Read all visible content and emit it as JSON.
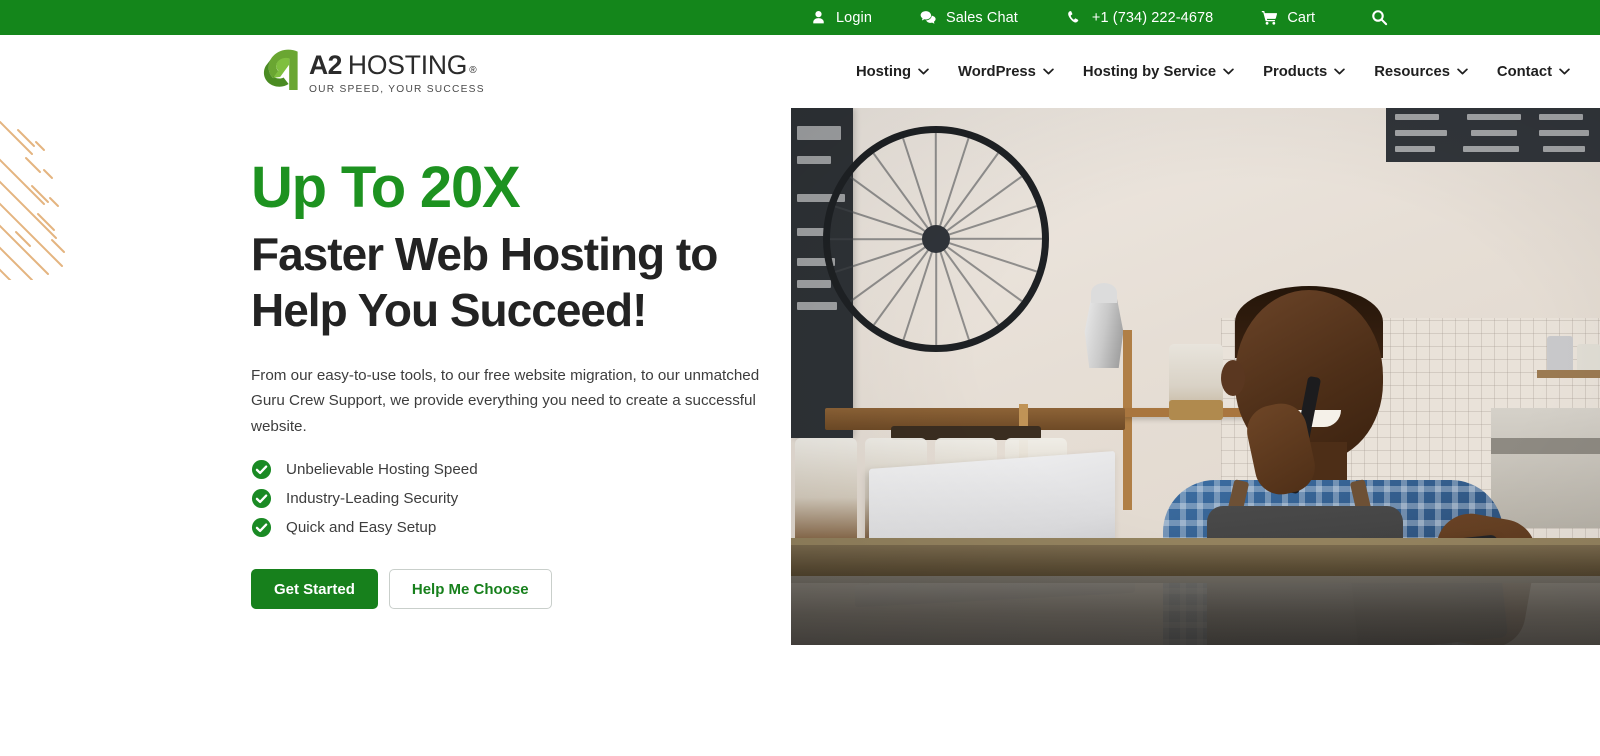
{
  "topbar": {
    "background": "#14861b",
    "items": [
      {
        "label": "Login",
        "icon": "user-icon"
      },
      {
        "label": "Sales Chat",
        "icon": "chat-bubbles-icon"
      },
      {
        "label": "+1 (734) 222-4678",
        "icon": "phone-icon"
      },
      {
        "label": "Cart",
        "icon": "shopping-cart-icon"
      }
    ],
    "search_icon": "search-icon"
  },
  "logo": {
    "mark": "a2-logo-mark",
    "brand_prefix": "A2",
    "brand_name": "HOSTING",
    "registered": "®",
    "tagline": "OUR SPEED, YOUR SUCCESS"
  },
  "nav": {
    "items": [
      {
        "label": "Hosting",
        "has_dropdown": true
      },
      {
        "label": "WordPress",
        "has_dropdown": true
      },
      {
        "label": "Hosting by Service",
        "has_dropdown": true
      },
      {
        "label": "Products",
        "has_dropdown": true
      },
      {
        "label": "Resources",
        "has_dropdown": true
      },
      {
        "label": "Contact",
        "has_dropdown": true
      }
    ],
    "dropdown_icon": "chevron-down-icon"
  },
  "hero": {
    "eyebrow": "Up To 20X",
    "headline": "Faster Web Hosting to Help You Succeed!",
    "subcopy": "From our easy-to-use tools, to our free website migration, to our unmatched Guru Crew Support, we provide everything you need to create a successful website.",
    "features": [
      {
        "label": "Unbelievable Hosting Speed",
        "icon": "check-circle-icon"
      },
      {
        "label": "Industry-Leading Security",
        "icon": "check-circle-icon"
      },
      {
        "label": "Quick and Easy Setup",
        "icon": "check-circle-icon"
      }
    ],
    "buttons": {
      "primary": "Get Started",
      "secondary": "Help Me Choose"
    },
    "image_alt": "Smiling small business owner on phone at cafe counter with laptop and tablet"
  },
  "colors": {
    "brand_green": "#14861b",
    "heading_green": "#1d9220",
    "button_green": "#17801c",
    "text_dark": "#232323",
    "body_text": "#3d3d3d",
    "stripe_accent": "#e0a86a"
  }
}
